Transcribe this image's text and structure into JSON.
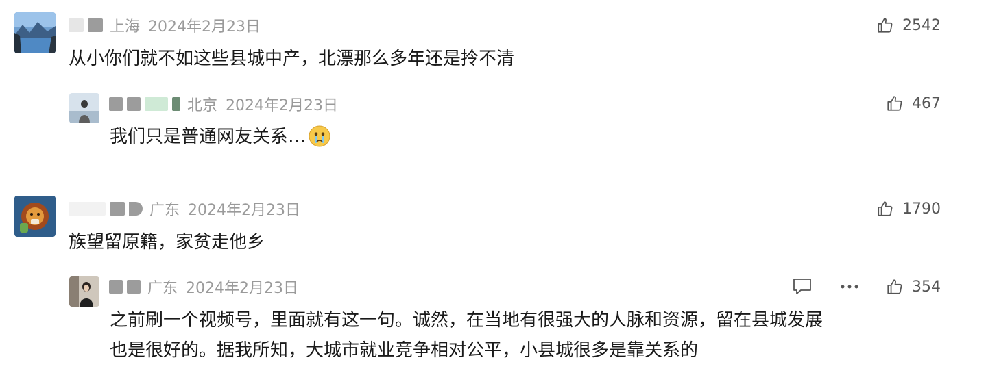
{
  "comments": [
    {
      "location": "上海",
      "date": "2024年2月23日",
      "text": "从小你们就不如这些县城中产，北漂那么多年还是拎不清",
      "likes": "2542",
      "avatar": "lake-landscape",
      "replies": [
        {
          "location": "北京",
          "date": "2024年2月23日",
          "text": "我们只是普通网友关系…",
          "emoji": "crying-face-emoji",
          "likes": "467",
          "avatar": "girl-by-sea"
        }
      ]
    },
    {
      "location": "广东",
      "date": "2024年2月23日",
      "text": "族望留原籍，家贫走他乡",
      "likes": "1790",
      "avatar": "cartoon-lion",
      "replies": [
        {
          "location": "广东",
          "date": "2024年2月23日",
          "text_lines": [
            "之前刷一个视频号，里面就有这一句。诚然，在当地有很强大的人脉和资源，留在县城发展",
            "也是很好的。据我所知，大城市就业竞争相对公平，小县城很多是靠关系的"
          ],
          "likes": "354",
          "avatar": "girl-portrait",
          "actions": [
            "reply-icon",
            "more-icon"
          ]
        }
      ]
    }
  ],
  "colors": {
    "meta_text": "#9a9a9a",
    "body_text": "#1a1a1a",
    "like_text": "#555555",
    "blur_gray": "#9c9c9c",
    "blur_light": "#e6e6e6",
    "blur_green": "#cfead6"
  }
}
